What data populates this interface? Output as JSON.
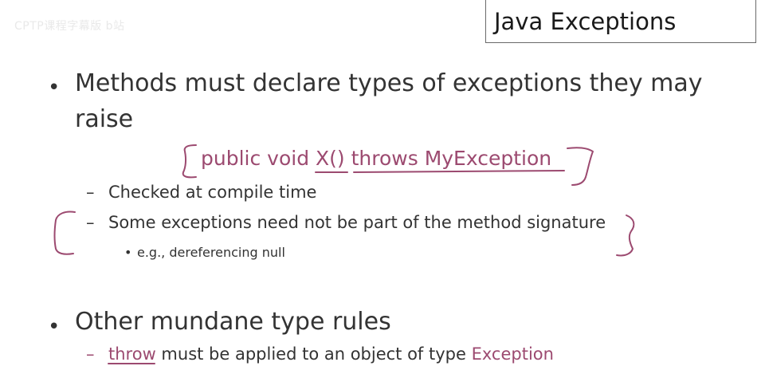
{
  "watermark": "CPTP课程字幕版 b站",
  "title": "Java Exceptions",
  "bullets": [
    {
      "text": "Methods must declare types of exceptions they may",
      "text_cont": "raise",
      "code_example": "public void X() throws MyException",
      "sub": [
        {
          "text": "Checked at compile time"
        },
        {
          "text": "Some exceptions need not be part of the method signature",
          "sub": [
            {
              "text": "e.g., dereferencing null"
            }
          ]
        }
      ]
    },
    {
      "text": "Other mundane type rules",
      "sub": [
        {
          "pre": "throw",
          "mid": " must be applied to an object of type ",
          "post": "Exception"
        }
      ]
    }
  ],
  "glyphs": {
    "bullet": "•",
    "dash": "–"
  },
  "colors": {
    "ink": "#9c4a70",
    "text": "#333333"
  }
}
